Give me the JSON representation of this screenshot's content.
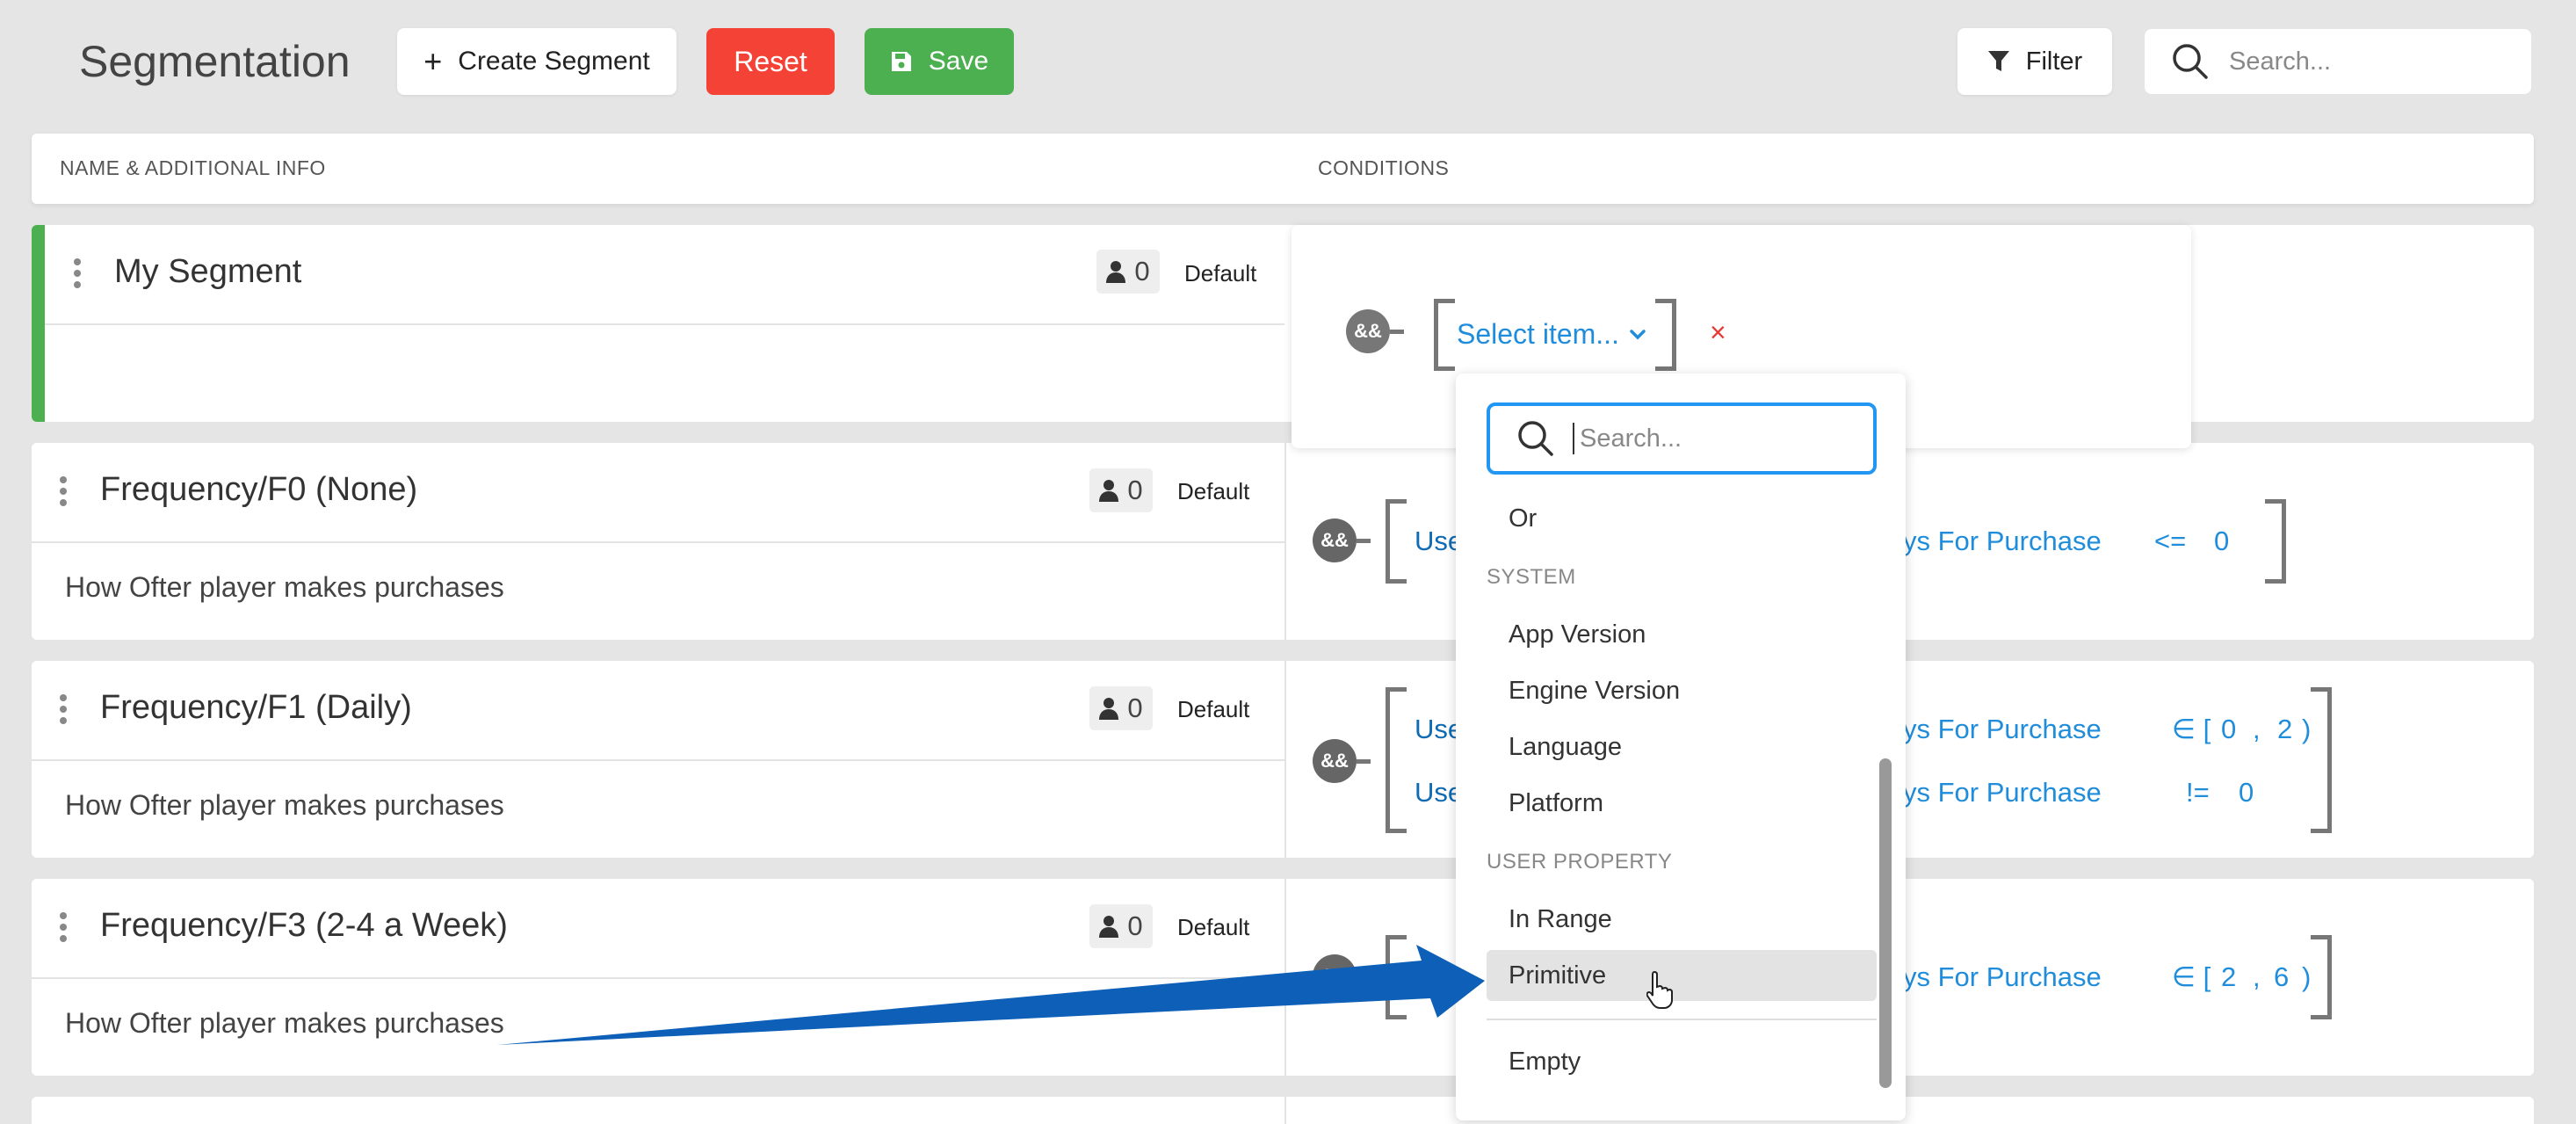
{
  "header": {
    "title": "Segmentation",
    "create_label": "Create Segment",
    "reset_label": "Reset",
    "save_label": "Save",
    "filter_label": "Filter",
    "search_placeholder": "Search..."
  },
  "columns": {
    "name": "NAME & ADDITIONAL INFO",
    "conditions": "CONDITIONS"
  },
  "segments": [
    {
      "name": "My Segment",
      "count": "0",
      "tag": "Default",
      "description": ""
    },
    {
      "name": "Frequency/F0 (None)",
      "count": "0",
      "tag": "Default",
      "description": "How Ofter player makes purchases",
      "cond_prefix": "Use",
      "cond_suffix": "ys For Purchase",
      "op": "<=",
      "val": "0"
    },
    {
      "name": "Frequency/F1 (Daily)",
      "count": "0",
      "tag": "Default",
      "description": "How Ofter player makes purchases",
      "cond1_prefix": "Use",
      "cond1_suffix": "ys For Purchase",
      "cond1_op": "∈ [",
      "cond1_a": "0",
      "cond1_sep": ",",
      "cond1_b": "2",
      "cond1_close": ")",
      "cond2_prefix": "Use",
      "cond2_suffix": "ys For Purchase",
      "cond2_op": "!=",
      "cond2_val": "0"
    },
    {
      "name": "Frequency/F3 (2-4 a Week)",
      "count": "0",
      "tag": "Default",
      "description": "How Ofter player makes purchases",
      "cond_suffix": "ys For Purchase",
      "op": "∈ [",
      "a": "2",
      "sep": ",",
      "b": "6",
      "close": ")"
    }
  ],
  "editor": {
    "and_label": "&&",
    "select_label": "Select item...",
    "remove_label": "×"
  },
  "dropdown": {
    "search_placeholder": "Search...",
    "or_label": "Or",
    "system_group": "SYSTEM",
    "system_items": [
      "App Version",
      "Engine Version",
      "Language",
      "Platform"
    ],
    "user_group": "USER PROPERTY",
    "user_items": [
      "In Range",
      "Primitive"
    ],
    "empty_label": "Empty"
  },
  "colors": {
    "reset": "#f44336",
    "save": "#4caf50",
    "link": "#1f8ddb",
    "active_segment": "#4caf50",
    "focus": "#2196f3",
    "arrow": "#0d5fb8"
  }
}
